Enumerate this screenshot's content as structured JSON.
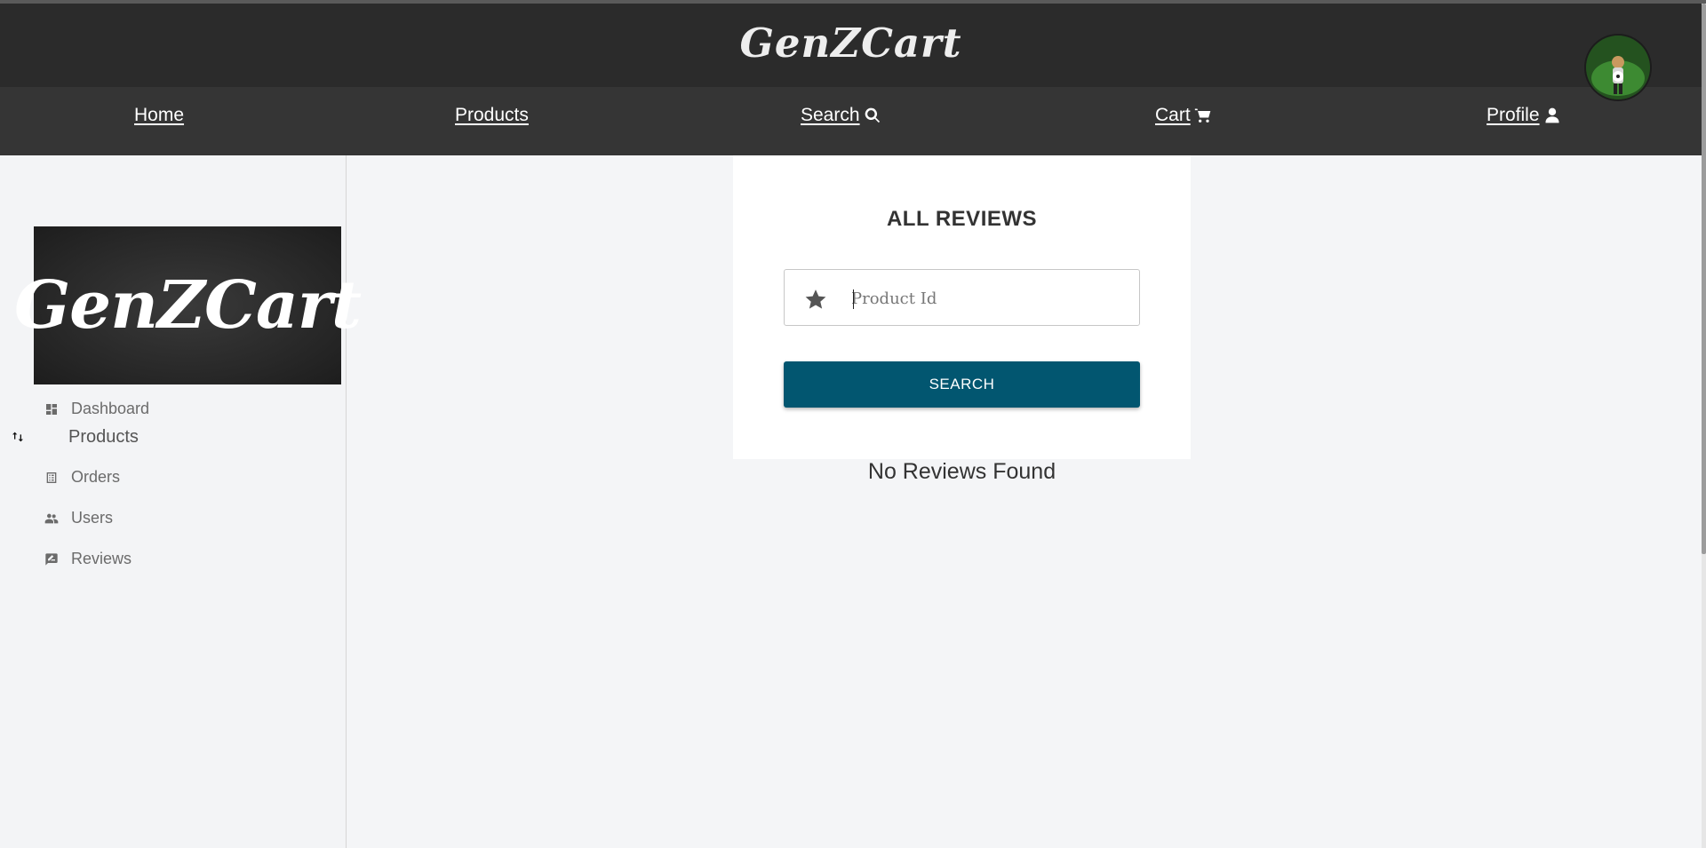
{
  "header": {
    "brand": "GenZCart"
  },
  "nav": {
    "home": "Home",
    "products": "Products",
    "search": "Search",
    "cart": "Cart",
    "profile": "Profile"
  },
  "sidebar": {
    "logo_text": "GenZCart",
    "items": [
      {
        "label": "Dashboard",
        "icon": "dashboard-icon"
      },
      {
        "label": "Products",
        "icon": "expand-collapse-icon"
      },
      {
        "label": "Orders",
        "icon": "list-icon"
      },
      {
        "label": "Users",
        "icon": "people-icon"
      },
      {
        "label": "Reviews",
        "icon": "rate-review-icon"
      }
    ]
  },
  "main": {
    "title": "ALL REVIEWS",
    "product_id_placeholder": "Product Id",
    "product_id_value": "",
    "search_button": "SEARCH",
    "empty_message": "No Reviews Found"
  },
  "colors": {
    "header_bg": "#2b2b2b",
    "nav_bg": "#353535",
    "button_bg": "#025670",
    "page_bg": "#f4f5f7"
  }
}
